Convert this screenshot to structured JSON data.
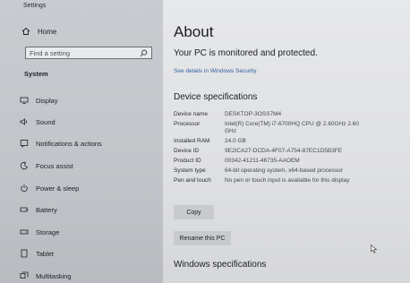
{
  "window": {
    "title": "Settings"
  },
  "sidebar": {
    "home_label": "Home",
    "search_placeholder": "Find a setting",
    "section_header": "System",
    "items": [
      {
        "label": "Display",
        "icon": "display-icon"
      },
      {
        "label": "Sound",
        "icon": "sound-icon"
      },
      {
        "label": "Notifications & actions",
        "icon": "notifications-icon"
      },
      {
        "label": "Focus assist",
        "icon": "focus-assist-icon"
      },
      {
        "label": "Power & sleep",
        "icon": "power-icon"
      },
      {
        "label": "Battery",
        "icon": "battery-icon"
      },
      {
        "label": "Storage",
        "icon": "storage-icon"
      },
      {
        "label": "Tablet",
        "icon": "tablet-icon"
      },
      {
        "label": "Multitasking",
        "icon": "multitasking-icon"
      }
    ]
  },
  "main": {
    "title": "About",
    "protection_status": "Your PC is monitored and protected.",
    "security_link": "See details in Windows Security",
    "device_specs_heading": "Device specifications",
    "specs": [
      {
        "label": "Device name",
        "value": "DESKTOP-3OSS7M4"
      },
      {
        "label": "Processor",
        "value": "Intel(R) Core(TM) i7-6700HQ CPU @ 2.60GHz   2.60 GHz"
      },
      {
        "label": "Installed RAM",
        "value": "24.0 GB"
      },
      {
        "label": "Device ID",
        "value": "9E2ICA27-DCDA-4F07-A754-87EC1D5B3FE"
      },
      {
        "label": "Product ID",
        "value": "00342-41211-46735-AAOEM"
      },
      {
        "label": "System type",
        "value": "64-bit operating system, x64-based processor"
      },
      {
        "label": "Pen and touch",
        "value": "No pen or touch input is available for this display"
      }
    ],
    "copy_button": "Copy",
    "rename_button": "Rename this PC",
    "windows_specs_heading": "Windows specifications"
  },
  "colors": {
    "accent": "#2f6fbf",
    "link": "#2f5f9e"
  }
}
